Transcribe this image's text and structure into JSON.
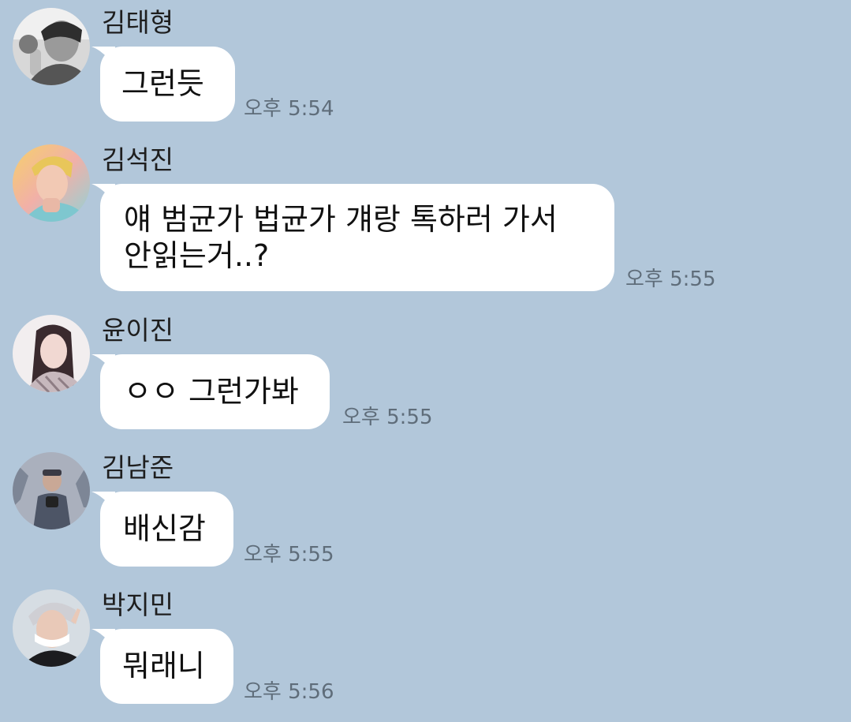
{
  "messages": [
    {
      "sender": "김태형",
      "text": "그런듯",
      "time": "오후 5:54"
    },
    {
      "sender": "김석진",
      "text": "얘 범균가 법균가 걔랑 톡하러 가서\n안읽는거..?",
      "time": "오후 5:55"
    },
    {
      "sender": "윤이진",
      "text": "ㅇㅇ 그런가봐",
      "time": "오후 5:55"
    },
    {
      "sender": "김남준",
      "text": "배신감",
      "time": "오후 5:55"
    },
    {
      "sender": "박지민",
      "text": "뭐래니",
      "time": "오후 5:56"
    }
  ],
  "colors": {
    "background": "#b2c7da",
    "bubble": "#ffffff",
    "time_text": "#5f6d7a"
  }
}
